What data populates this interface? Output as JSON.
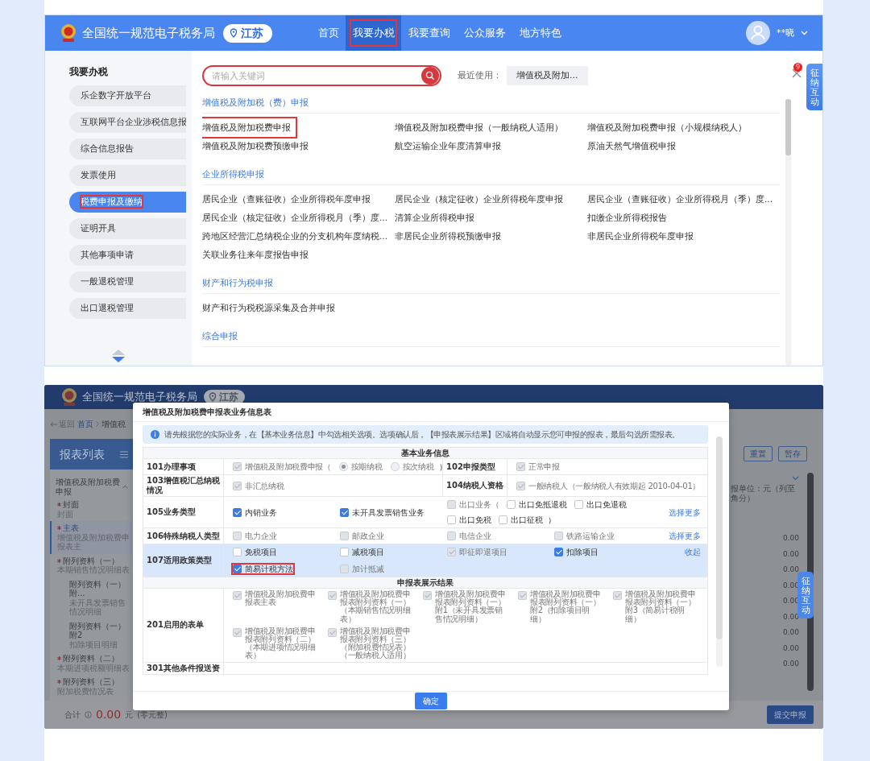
{
  "top_panel": {
    "header": {
      "site_title": "全国统一规范电子税务局",
      "region": "江苏",
      "nav": [
        {
          "label": "首页",
          "selected": false,
          "highlighted": false
        },
        {
          "label": "我要办税",
          "selected": true,
          "highlighted": true
        },
        {
          "label": "我要查询",
          "selected": false,
          "highlighted": false
        },
        {
          "label": "公众服务",
          "selected": false,
          "highlighted": false
        },
        {
          "label": "地方特色",
          "selected": false,
          "highlighted": false
        }
      ],
      "user_name": "**晓"
    },
    "sidebar": {
      "title": "我要办税",
      "items": [
        {
          "label": "乐企数字开放平台",
          "selected": false,
          "highlighted": false
        },
        {
          "label": "互联网平台企业涉税信息报",
          "selected": false,
          "highlighted": false
        },
        {
          "label": "综合信息报告",
          "selected": false,
          "highlighted": false
        },
        {
          "label": "发票使用",
          "selected": false,
          "highlighted": false
        },
        {
          "label": "税费申报及缴纳",
          "selected": true,
          "highlighted": true
        },
        {
          "label": "证明开具",
          "selected": false,
          "highlighted": false
        },
        {
          "label": "其他事项申请",
          "selected": false,
          "highlighted": false
        },
        {
          "label": "一般退税管理",
          "selected": false,
          "highlighted": false
        },
        {
          "label": "出口退税管理",
          "selected": false,
          "highlighted": false
        }
      ]
    },
    "search": {
      "placeholder": "请输入关键词"
    },
    "recent": {
      "label": "最近使用：",
      "items": [
        "增值税及附加..."
      ]
    },
    "notification_count": "9",
    "side_tab": "征纳互动",
    "sections": [
      {
        "title": "增值税及附加税（费）申报",
        "items": [
          {
            "label": "增值税及附加税费申报",
            "highlighted": true
          },
          {
            "label": "增值税及附加税费申报（一般纳税人适用）",
            "highlighted": false
          },
          {
            "label": "增值税及附加税费申报（小规模纳税人）",
            "highlighted": false
          },
          {
            "label": "增值税及附加税费预缴申报",
            "highlighted": false
          },
          {
            "label": "航空运输企业年度清算申报",
            "highlighted": false
          },
          {
            "label": "原油天然气增值税申报",
            "highlighted": false
          }
        ]
      },
      {
        "title": "企业所得税申报",
        "items": [
          {
            "label": "居民企业（查账征收）企业所得税年度申报",
            "highlighted": false
          },
          {
            "label": "居民企业（核定征收）企业所得税年度申报",
            "highlighted": false
          },
          {
            "label": "居民企业（查账征收）企业所得税月（季）度...",
            "highlighted": false
          },
          {
            "label": "居民企业（核定征收）企业所得税月（季）度...",
            "highlighted": false
          },
          {
            "label": "清算企业所得税申报",
            "highlighted": false
          },
          {
            "label": "扣缴企业所得税报告",
            "highlighted": false
          },
          {
            "label": "跨地区经营汇总纳税企业的分支机构年度纳税...",
            "highlighted": false
          },
          {
            "label": "非居民企业所得税预缴申报",
            "highlighted": false
          },
          {
            "label": "非居民企业所得税年度申报",
            "highlighted": false
          },
          {
            "label": "关联业务往来年度报告申报",
            "highlighted": false
          }
        ]
      },
      {
        "title": "财产和行为税申报",
        "items": [
          {
            "label": "财产和行为税税源采集及合并申报",
            "highlighted": false
          }
        ]
      },
      {
        "title": "综合申报"
      }
    ]
  },
  "bottom_panel": {
    "background_page": {
      "site_title": "全国统一规范电子税务局",
      "region": "江苏",
      "back_link": "返回",
      "breadcrumb": [
        "首页",
        "增值税"
      ],
      "report_list_title": "报表列表",
      "report_group": "增值税及附加税费申报",
      "group_expanded": true,
      "reports": [
        {
          "title": "封面",
          "subtitle": "封面",
          "required": true,
          "selected": false
        },
        {
          "title": "主表",
          "subtitle": "增值税及附加税费申报表主",
          "required": true,
          "selected": true
        },
        {
          "title": "附列资料（一）",
          "subtitle": "本期销售情况明细表",
          "required": true,
          "selected": false,
          "children": [
            {
              "title": "附列资料（一）附...",
              "subtitle": "未开具发票销售情况明细",
              "required": false,
              "selected": false
            },
            {
              "title": "附列资料（一）附2",
              "subtitle": "扣除项目明细",
              "required": false,
              "selected": false
            }
          ]
        },
        {
          "title": "附列资料（二）",
          "subtitle": "本期进项税额明细表",
          "required": true,
          "selected": false
        },
        {
          "title": "附列资料（三）",
          "subtitle": "附加税费情况表",
          "required": true,
          "selected": false
        }
      ],
      "toolbar_buttons": [
        "重置",
        "暂存"
      ],
      "unit_note": "报单位：元（列至角分）",
      "amounts": [
        "0.00",
        "0.00",
        "0.00",
        "0.00",
        "0.00",
        "0.00",
        "0.00",
        "0.00",
        "0.00"
      ],
      "total_label": "合计",
      "total_amount": "0.00",
      "total_unit": "元",
      "total_words": "(零元整)",
      "submit_button": "提交申报",
      "side_tab": "征纳互动"
    },
    "modal": {
      "title": "增值税及附加税费申报表业务信息表",
      "notice": "请先根据您的实际业务，在【基本业务信息】中勾选相关选项。选项确认后，【申报表展示结果】区域将自动显示您可申报的报表，最后勾选所需报表。",
      "sections": [
        {
          "title": "基本业务信息",
          "rows": [
            {
              "kind": "pair",
              "label": "101办理事项",
              "content": [
                {
                  "kind": "checkbox",
                  "label": "增值税及附加税费申报（",
                  "checked": true,
                  "disabled": true
                },
                {
                  "kind": "radio",
                  "label": "按期纳税",
                  "selected": true,
                  "disabled": true
                },
                {
                  "kind": "radio",
                  "label": "按次纳税",
                  "selected": false,
                  "disabled": true
                },
                {
                  "kind": "text",
                  "label": "）"
                }
              ],
              "label2": "102申报类型",
              "content2": [
                {
                  "kind": "checkbox",
                  "label": "正常申报",
                  "checked": true,
                  "disabled": true
                }
              ]
            },
            {
              "kind": "pair",
              "label": "103增值税汇总纳税情况",
              "content": [
                {
                  "kind": "checkbox",
                  "label": "非汇总纳税",
                  "checked": true,
                  "disabled": true
                }
              ],
              "label2": "104纳税人资格",
              "content2": [
                {
                  "kind": "checkbox",
                  "label": "一般纳税人（一般纳税人有效期起 2010-04-01）",
                  "checked": true,
                  "disabled": true
                }
              ]
            },
            {
              "kind": "options",
              "label": "105业务类型",
              "expanded": false,
              "link": "选择更多",
              "options": [
                {
                  "kind": "checkbox",
                  "label": "内销业务",
                  "checked": true,
                  "disabled": false,
                  "highlighted": false
                },
                {
                  "kind": "checkbox",
                  "label": "未开具发票销售业务",
                  "checked": true,
                  "disabled": false,
                  "highlighted": false
                },
                {
                  "kind": "group",
                  "label": "出口业务（",
                  "checked": false,
                  "disabled": true,
                  "highlighted": false,
                  "close": "）",
                  "options": [
                    {
                      "label": "出口免抵退税",
                      "checked": false,
                      "disabled": false
                    },
                    {
                      "label": "出口免退税",
                      "checked": false,
                      "disabled": false
                    },
                    {
                      "label": "出口免税",
                      "checked": false,
                      "disabled": false
                    },
                    {
                      "label": "出口征税",
                      "checked": false,
                      "disabled": false
                    }
                  ]
                }
              ]
            },
            {
              "kind": "options",
              "label": "106特殊纳税人类型",
              "expanded": false,
              "link": "选择更多",
              "options": [
                {
                  "kind": "checkbox",
                  "label": "电力企业",
                  "checked": false,
                  "disabled": true,
                  "highlighted": false
                },
                {
                  "kind": "checkbox",
                  "label": "邮政企业",
                  "checked": false,
                  "disabled": true,
                  "highlighted": false
                },
                {
                  "kind": "checkbox",
                  "label": "电信企业",
                  "checked": false,
                  "disabled": true,
                  "highlighted": false
                },
                {
                  "kind": "checkbox",
                  "label": "铁路运输企业",
                  "checked": false,
                  "disabled": true,
                  "highlighted": false
                }
              ]
            },
            {
              "kind": "options",
              "label": "107适用政策类型",
              "expanded": true,
              "link": "收起",
              "options": [
                {
                  "kind": "checkbox",
                  "label": "免税项目",
                  "checked": false,
                  "disabled": false,
                  "highlighted": false
                },
                {
                  "kind": "checkbox",
                  "label": "减税项目",
                  "checked": false,
                  "disabled": false,
                  "highlighted": false
                },
                {
                  "kind": "checkbox",
                  "label": "即征即退项目",
                  "checked": true,
                  "disabled": true,
                  "highlighted": false
                },
                {
                  "kind": "checkbox",
                  "label": "扣除项目",
                  "checked": true,
                  "disabled": false,
                  "highlighted": false
                },
                {
                  "kind": "checkbox",
                  "label": "简易计税方法",
                  "checked": true,
                  "disabled": false,
                  "highlighted": true
                },
                {
                  "kind": "checkbox",
                  "label": "加计抵减",
                  "checked": false,
                  "disabled": true,
                  "highlighted": false
                }
              ]
            }
          ]
        },
        {
          "title": "申报表展示结果",
          "rows": [
            {
              "kind": "forms",
              "label": "201启用的表单",
              "options": [
                {
                  "kind": "checkbox",
                  "label": "增值税及附加税费申报表主表",
                  "checked": true,
                  "disabled": true
                },
                {
                  "kind": "checkbox",
                  "label": "增值税及附加税费申报表附列资料（一）（本期销售情况明细表）",
                  "checked": true,
                  "disabled": true
                },
                {
                  "kind": "checkbox",
                  "label": "增值税及附加税费申报表附列资料（一）附1（未开具发票销售情况明细）",
                  "checked": true,
                  "disabled": true
                },
                {
                  "kind": "checkbox",
                  "label": "增值税及附加税费申报表附列资料（一）附2（扣除项目明细）",
                  "checked": true,
                  "disabled": true
                },
                {
                  "kind": "checkbox",
                  "label": "增值税及附加税费申报表附列资料（一）附3（简易计税明细）",
                  "checked": true,
                  "disabled": true
                },
                {
                  "kind": "checkbox",
                  "label": "增值税及附加税费申报表附列资料（二）（本期进项情况明细表）",
                  "checked": true,
                  "disabled": true
                },
                {
                  "kind": "checkbox",
                  "label": "增值税及附加税费申报表附列资料（三）（附加税费情况表）（一般纳税人适用）",
                  "checked": true,
                  "disabled": true
                }
              ]
            },
            {
              "kind": "empty",
              "label": "301其他条件报送资"
            }
          ]
        }
      ],
      "confirm_button": "确定"
    }
  }
}
